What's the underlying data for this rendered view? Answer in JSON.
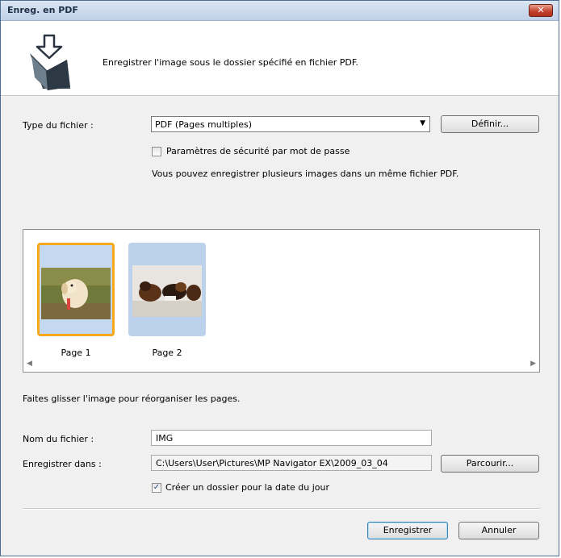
{
  "window": {
    "title": "Enreg. en PDF",
    "close_glyph": "✕"
  },
  "header": {
    "description": "Enregistrer l'image sous le dossier spécifié en fichier PDF."
  },
  "file_type": {
    "label": "Type du fichier :",
    "selected": "PDF (Pages multiples)",
    "define_button": "Définir..."
  },
  "security": {
    "checkbox_label": "Paramètres de sécurité par mot de passe",
    "checked": false
  },
  "info_text": "Vous pouvez enregistrer plusieurs images dans un même fichier PDF.",
  "pages": [
    {
      "label": "Page 1",
      "selected": true
    },
    {
      "label": "Page 2",
      "selected": false
    }
  ],
  "drag_hint": "Faites glisser l'image pour réorganiser les pages.",
  "file_name": {
    "label": "Nom du fichier :",
    "value": "IMG"
  },
  "save_in": {
    "label": "Enregistrer dans :",
    "value": "C:\\Users\\User\\Pictures\\MP Navigator EX\\2009_03_04",
    "browse_button": "Parcourir..."
  },
  "date_folder": {
    "checkbox_label": "Créer un dossier pour la date du jour",
    "checked": true
  },
  "footer": {
    "save_button": "Enregistrer",
    "cancel_button": "Annuler"
  },
  "colors": {
    "selection": "#f7a81b",
    "thumb_bg": "#bcd2ec"
  },
  "icons": {
    "header": "pdf-save-folder-icon",
    "combo_arrow": "▼",
    "scroll_left": "◀",
    "scroll_right": "▶",
    "check_mark": "✓"
  }
}
